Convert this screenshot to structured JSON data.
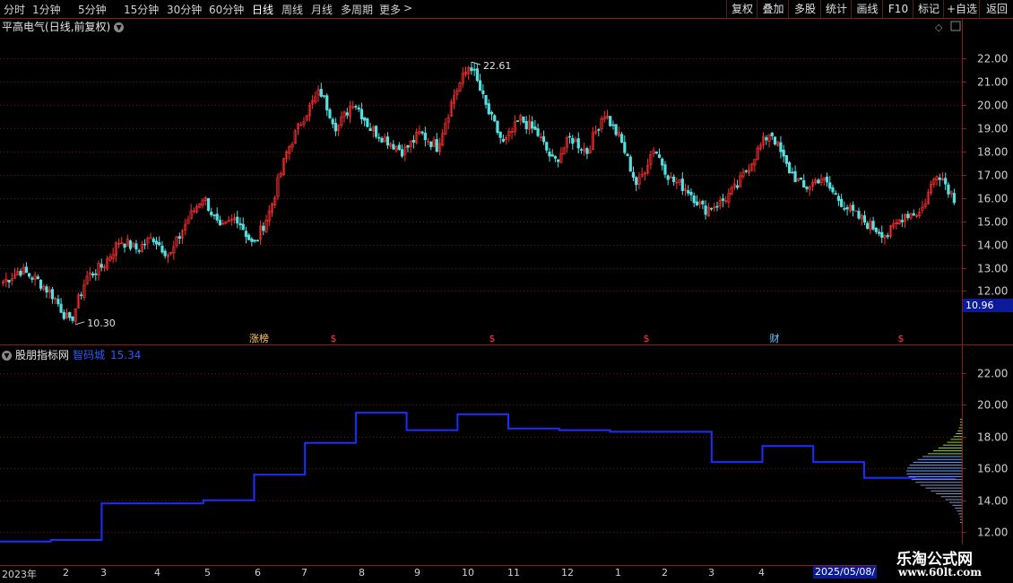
{
  "toolbar": {
    "periods": [
      "分时",
      "1分钟",
      "5分钟",
      "15分钟",
      "30分钟",
      "60分钟",
      "日线",
      "周线",
      "月线",
      "多周期",
      "更多"
    ],
    "active_period": "日线",
    "right_buttons": [
      "复权",
      "叠加",
      "多股",
      "统计",
      "画线",
      "F10",
      "标记",
      "+自选",
      "返回"
    ]
  },
  "main_panel": {
    "stock_name": "平高电气",
    "mode": "(日线,前复权)",
    "current_price_box": "10.96"
  },
  "indicator_panel": {
    "source_name": "股朋指标网",
    "line_name": "智码城",
    "value": "15.34"
  },
  "watermark": {
    "title": "乐淘公式网",
    "url": "www.60lt.com"
  },
  "colors": {
    "up": "#ff3030",
    "down": "#55e0e0",
    "grid": "#7a1010",
    "line": "#1a2fff",
    "frame": "#8a1b1b"
  },
  "chart_data": [
    {
      "type": "candlestick",
      "title": "平高电气(日线,前复权)",
      "y_ticks": [
        12.0,
        13.0,
        14.0,
        15.0,
        16.0,
        17.0,
        18.0,
        19.0,
        20.0,
        21.0,
        22.0
      ],
      "ylim": [
        11.4,
        22.9
      ],
      "annotations": [
        {
          "label": "22.61",
          "type": "high"
        },
        {
          "label": "10.30",
          "type": "low"
        }
      ],
      "event_markers": [
        {
          "label": "涨榜",
          "month": "7"
        },
        {
          "label": "$",
          "month": "7"
        },
        {
          "label": "$",
          "month": "10"
        },
        {
          "label": "$",
          "month": "1"
        },
        {
          "label": "财",
          "month": "4"
        },
        {
          "label": "$",
          "month": "5"
        }
      ],
      "close_path": [
        {
          "m": "2023-01",
          "v": 12.4
        },
        {
          "m": "2023-01",
          "v": 12.9
        },
        {
          "m": "2023-01",
          "v": 12.5
        },
        {
          "m": "2023-02",
          "v": 11.8
        },
        {
          "m": "2023-02",
          "v": 10.6
        },
        {
          "m": "2023-02",
          "v": 12.6
        },
        {
          "m": "2023-03",
          "v": 13.1
        },
        {
          "m": "2023-03",
          "v": 14.2
        },
        {
          "m": "2023-03",
          "v": 13.8
        },
        {
          "m": "2023-04",
          "v": 14.3
        },
        {
          "m": "2023-04",
          "v": 13.5
        },
        {
          "m": "2023-04",
          "v": 15.0
        },
        {
          "m": "2023-05",
          "v": 16.1
        },
        {
          "m": "2023-05",
          "v": 14.6
        },
        {
          "m": "2023-05",
          "v": 15.2
        },
        {
          "m": "2023-06",
          "v": 13.9
        },
        {
          "m": "2023-06",
          "v": 15.5
        },
        {
          "m": "2023-06",
          "v": 18.0
        },
        {
          "m": "2023-07",
          "v": 19.5
        },
        {
          "m": "2023-07",
          "v": 20.6
        },
        {
          "m": "2023-07",
          "v": 19.0
        },
        {
          "m": "2023-08",
          "v": 20.2
        },
        {
          "m": "2023-08",
          "v": 19.0
        },
        {
          "m": "2023-08",
          "v": 18.5
        },
        {
          "m": "2023-09",
          "v": 18.0
        },
        {
          "m": "2023-09",
          "v": 18.8
        },
        {
          "m": "2023-09",
          "v": 18.2
        },
        {
          "m": "2023-10",
          "v": 20.4
        },
        {
          "m": "2023-10",
          "v": 21.8
        },
        {
          "m": "2023-10",
          "v": 19.8
        },
        {
          "m": "2023-11",
          "v": 18.3
        },
        {
          "m": "2023-11",
          "v": 19.4
        },
        {
          "m": "2023-11",
          "v": 18.8
        },
        {
          "m": "2023-12",
          "v": 17.5
        },
        {
          "m": "2023-12",
          "v": 18.6
        },
        {
          "m": "2023-12",
          "v": 18.0
        },
        {
          "m": "2024-01",
          "v": 19.7
        },
        {
          "m": "2024-01",
          "v": 18.5
        },
        {
          "m": "2024-01",
          "v": 16.5
        },
        {
          "m": "2024-02",
          "v": 18.2
        },
        {
          "m": "2024-02",
          "v": 16.8
        },
        {
          "m": "2024-02",
          "v": 16.4
        },
        {
          "m": "2024-03",
          "v": 15.5
        },
        {
          "m": "2024-03",
          "v": 15.8
        },
        {
          "m": "2024-03",
          "v": 16.5
        },
        {
          "m": "2024-04",
          "v": 17.8
        },
        {
          "m": "2024-04",
          "v": 18.9
        },
        {
          "m": "2024-04",
          "v": 17.3
        },
        {
          "m": "2024-05",
          "v": 16.4
        },
        {
          "m": "2024-05",
          "v": 16.9
        },
        {
          "m": "2024-05",
          "v": 16.0
        },
        {
          "m": "2024-06",
          "v": 15.3
        },
        {
          "m": "2024-06",
          "v": 14.8
        },
        {
          "m": "2024-06",
          "v": 14.4
        },
        {
          "m": "2024-07",
          "v": 15.3
        },
        {
          "m": "2024-07",
          "v": 15.4
        },
        {
          "m": "2024-07",
          "v": 17.2
        },
        {
          "m": "2024-07",
          "v": 16.0
        }
      ]
    },
    {
      "type": "line",
      "series": [
        {
          "name": "智码城",
          "last": 15.34
        }
      ],
      "y_ticks": [
        12.0,
        14.0,
        16.0,
        18.0,
        20.0,
        22.0
      ],
      "ylim": [
        11.5,
        23.0
      ],
      "steps": [
        {
          "m": "2023-01",
          "v": 11.4
        },
        {
          "m": "2023-02",
          "v": 11.5
        },
        {
          "m": "2023-03",
          "v": 13.8
        },
        {
          "m": "2023-04",
          "v": 13.8
        },
        {
          "m": "2023-05",
          "v": 14.0
        },
        {
          "m": "2023-06",
          "v": 15.6
        },
        {
          "m": "2023-07",
          "v": 17.6
        },
        {
          "m": "2023-08",
          "v": 19.5
        },
        {
          "m": "2023-09",
          "v": 18.4
        },
        {
          "m": "2023-10",
          "v": 19.4
        },
        {
          "m": "2023-11",
          "v": 18.5
        },
        {
          "m": "2023-12",
          "v": 18.4
        },
        {
          "m": "2024-01",
          "v": 18.3
        },
        {
          "m": "2024-02",
          "v": 18.3
        },
        {
          "m": "2024-03",
          "v": 16.4
        },
        {
          "m": "2024-04",
          "v": 17.4
        },
        {
          "m": "2024-05",
          "v": 16.4
        },
        {
          "m": "2024-06",
          "v": 15.4
        },
        {
          "m": "2024-07",
          "v": 15.34
        }
      ]
    }
  ],
  "x_axis": {
    "labels": [
      "2023年",
      "2",
      "3",
      "4",
      "5",
      "6",
      "7",
      "8",
      "9",
      "10",
      "11",
      "12",
      "1",
      "2",
      "3",
      "4"
    ],
    "current_date": "2025/05/08/"
  }
}
